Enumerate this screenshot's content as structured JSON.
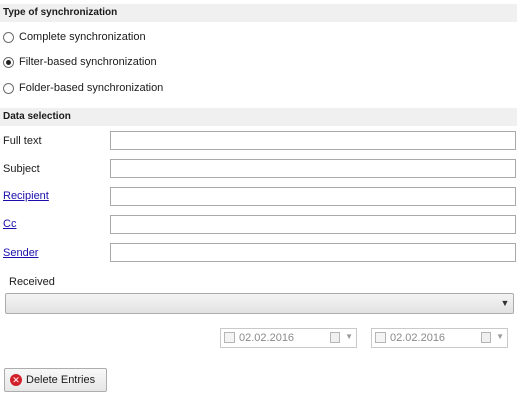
{
  "sync_type": {
    "header": "Type of synchronization",
    "options": [
      {
        "label": "Complete synchronization",
        "selected": false
      },
      {
        "label": "Filter-based synchronization",
        "selected": true
      },
      {
        "label": "Folder-based synchronization",
        "selected": false
      }
    ]
  },
  "data_selection": {
    "header": "Data selection",
    "fields": [
      {
        "label": "Full text",
        "link": false,
        "value": ""
      },
      {
        "label": "Subject",
        "link": false,
        "value": ""
      },
      {
        "label": "Recipient",
        "link": true,
        "value": ""
      },
      {
        "label": "Cc",
        "link": true,
        "value": ""
      },
      {
        "label": "Sender",
        "link": true,
        "value": ""
      }
    ],
    "received_label": "Received",
    "received_value": "",
    "date_from": "02.02.2016",
    "date_to": "02.02.2016"
  },
  "actions": {
    "delete_label": "Delete Entries"
  },
  "colors": {
    "link": "#1a0dab",
    "header_bg": "#f0f0f0",
    "delete_icon": "#d2202a"
  }
}
